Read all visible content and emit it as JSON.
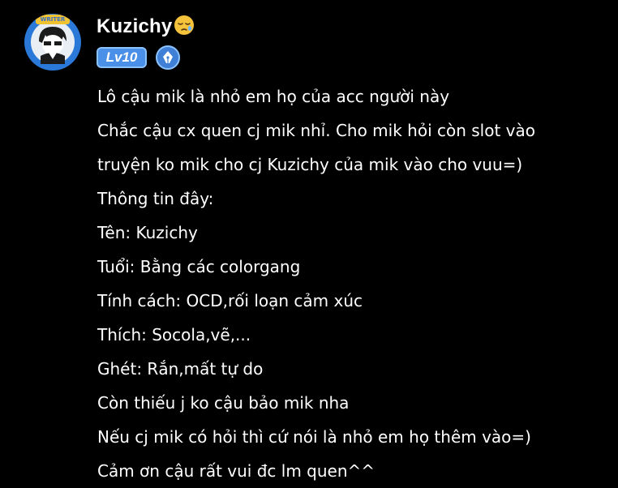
{
  "post": {
    "author": {
      "name": "Kuzichy",
      "avatar_badge_text": "WRITER",
      "level_label": "Lv10",
      "name_emoji": "sleepy-face-emoji",
      "title_icon": "pen-nib-icon"
    },
    "lines": [
      "Lô cậu mik là nhỏ em họ của acc người này",
      "Chắc cậu cx quen cj mik nhỉ. Cho mik hỏi còn slot vào",
      "truyện ko mik cho cj Kuzichy của mik vào cho vuu=)",
      "Thông tin đây:",
      "Tên: Kuzichy",
      "Tuổi: Bằng các colorgang",
      "Tính cách: OCD,rối loạn cảm xúc",
      "Thích: Socola,vẽ,...",
      "Ghét: Rắn,mất tự do",
      "Còn thiếu j ko cậu bảo mik nha",
      "Nếu cj mik có hỏi thì cứ nói là nhỏ em họ thêm vào=)",
      "Cảm ơn cậu rất vui đc lm quen^^"
    ]
  },
  "colors": {
    "background": "#000000",
    "text": "#ffffff",
    "level_badge": "#4a8fe8",
    "badge_border": "#8cc3ff",
    "emoji": "#f5c33b"
  }
}
